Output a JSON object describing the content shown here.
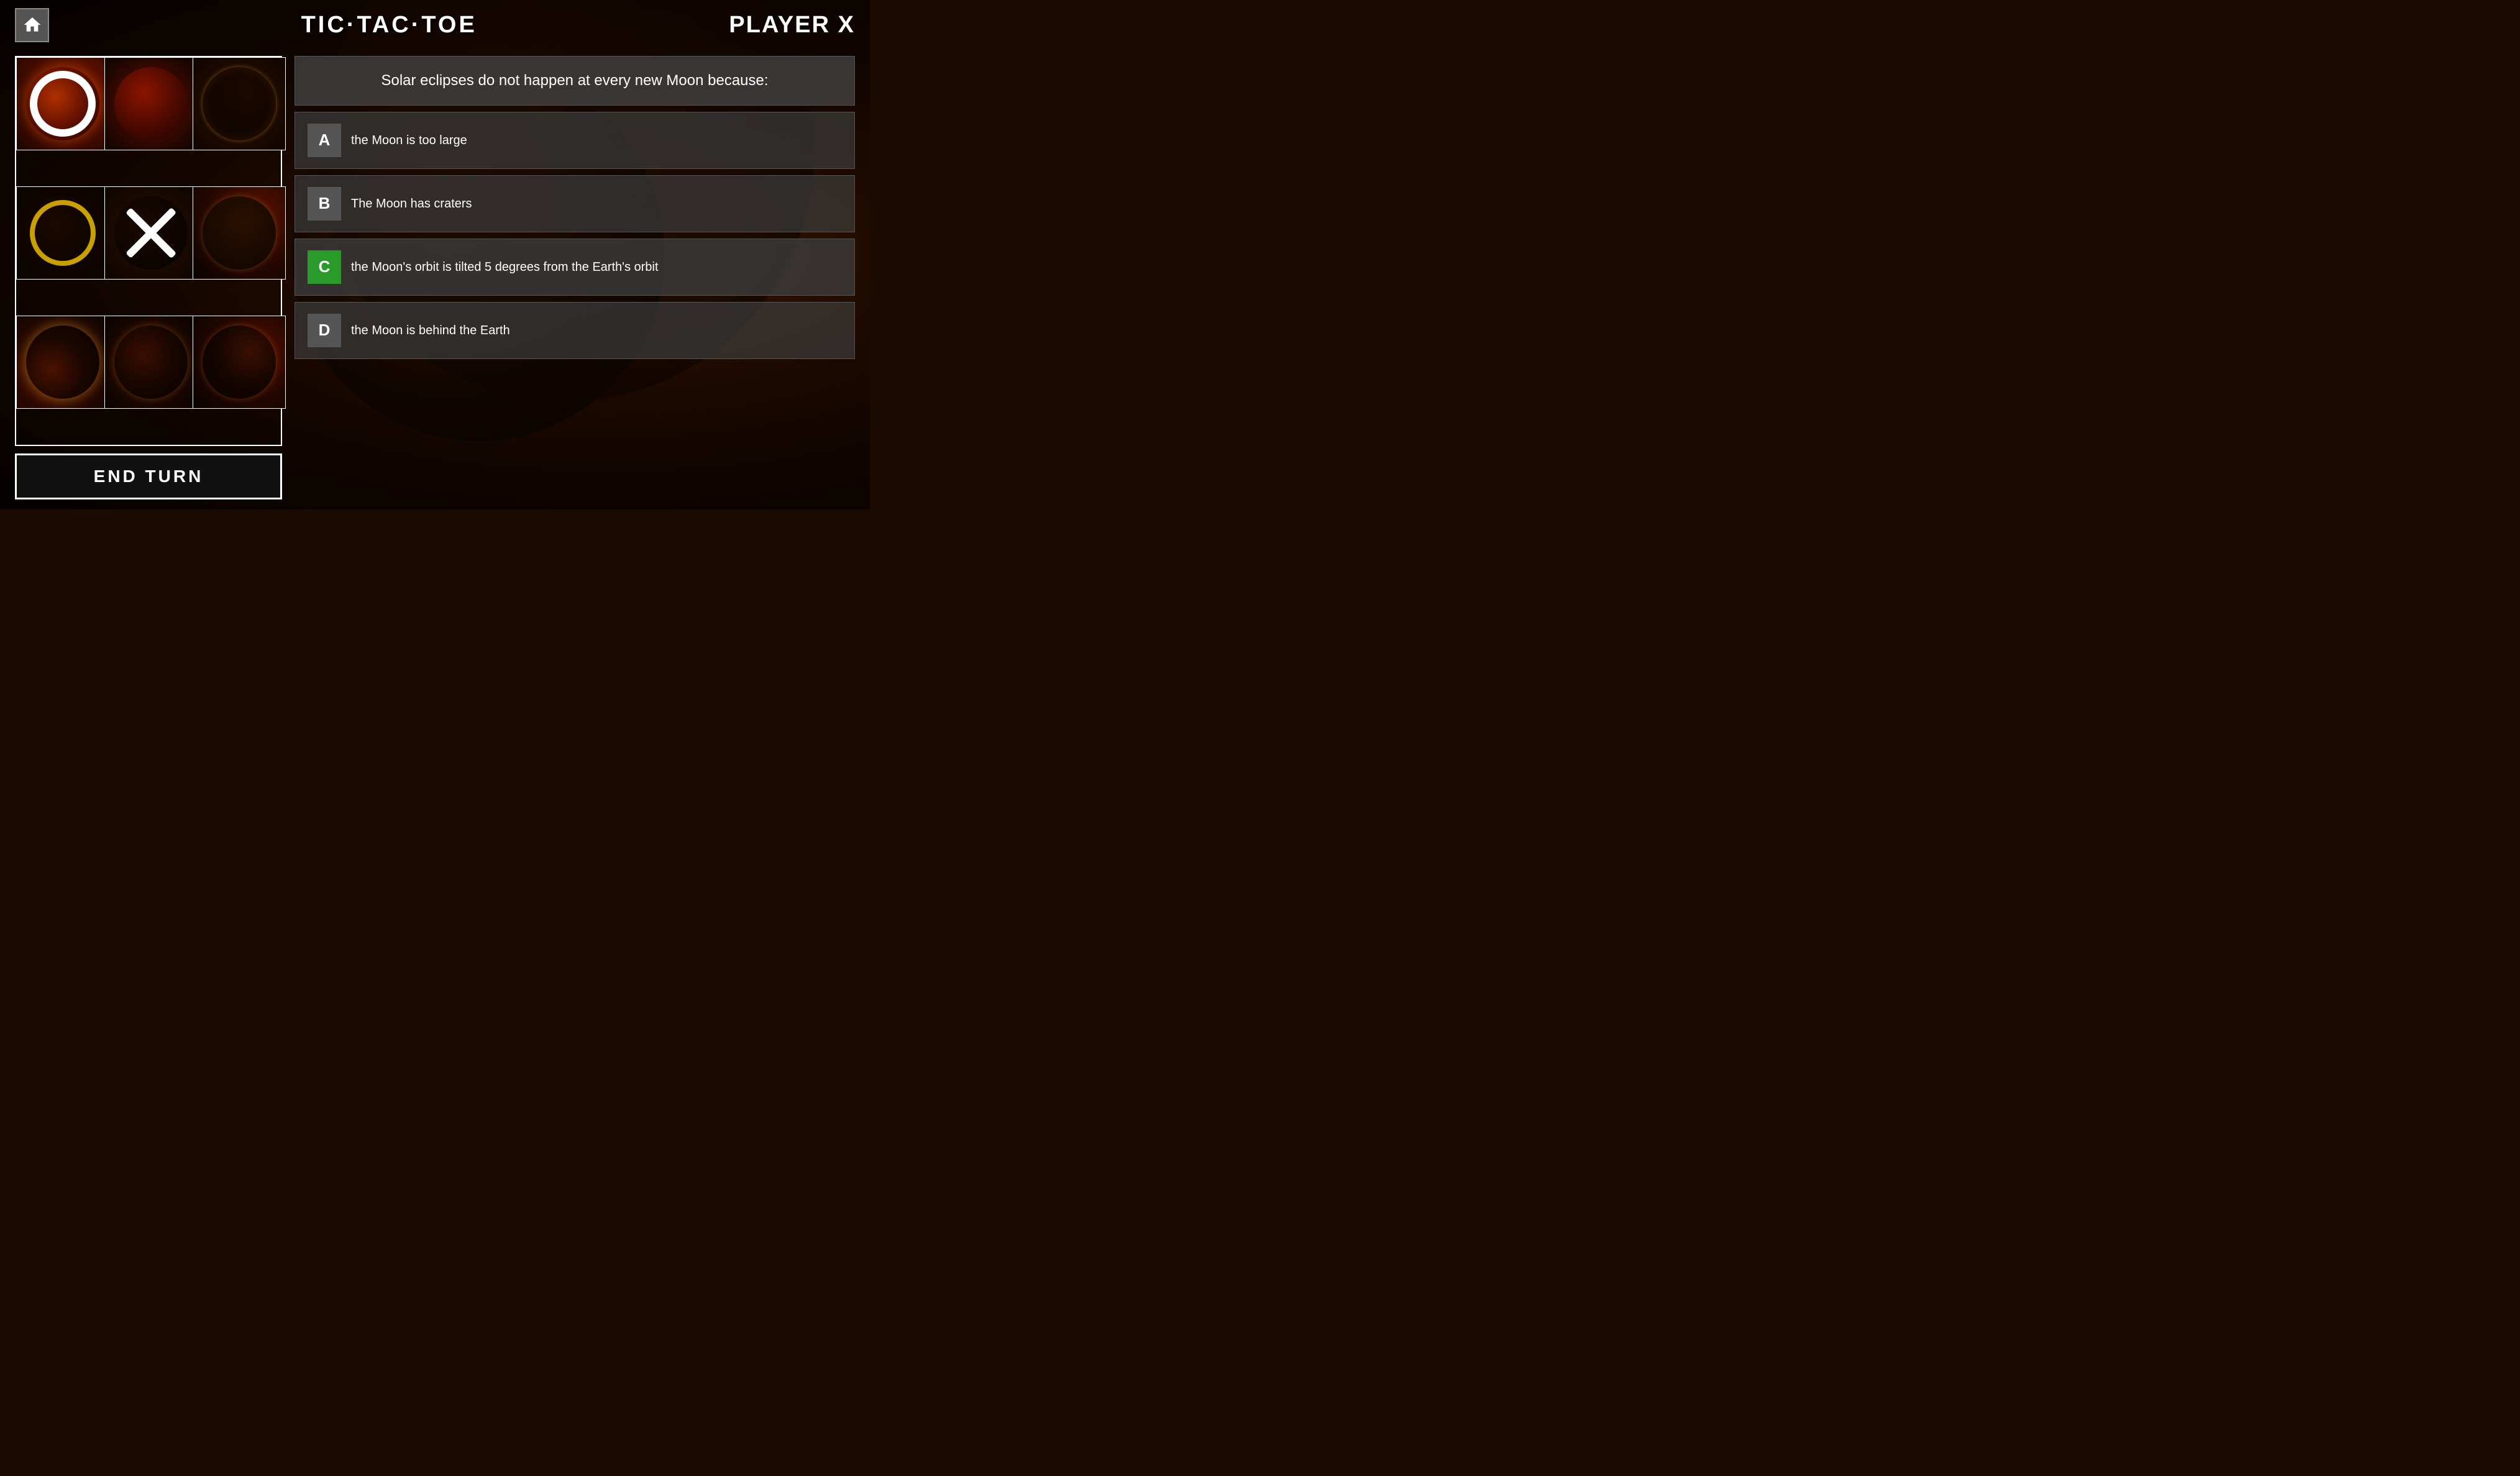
{
  "header": {
    "title": "TIC·TAC·TOE",
    "player_label": "PLAYER X"
  },
  "board": {
    "cells": [
      {
        "id": 1,
        "marker": "o-white",
        "bg_class": "eclipse-1 planet-1"
      },
      {
        "id": 2,
        "marker": null,
        "bg_class": "eclipse-2 planet-2"
      },
      {
        "id": 3,
        "marker": null,
        "bg_class": "eclipse-3 planet-3"
      },
      {
        "id": 4,
        "marker": "o-gold",
        "bg_class": "eclipse-4 planet-4"
      },
      {
        "id": 5,
        "marker": "x",
        "bg_class": "eclipse-5 planet-5"
      },
      {
        "id": 6,
        "marker": null,
        "bg_class": "eclipse-6 planet-6"
      },
      {
        "id": 7,
        "marker": null,
        "bg_class": "eclipse-7 planet-7"
      },
      {
        "id": 8,
        "marker": null,
        "bg_class": "eclipse-8 planet-8"
      },
      {
        "id": 9,
        "marker": null,
        "bg_class": "eclipse-9 planet-9"
      }
    ]
  },
  "end_turn_label": "END TURN",
  "question": {
    "text": "Solar eclipses do not happen at every new Moon because:",
    "answers": [
      {
        "letter": "A",
        "text": "the Moon is too large",
        "selected": false,
        "correct": false
      },
      {
        "letter": "B",
        "text": "The Moon has craters",
        "selected": false,
        "correct": false
      },
      {
        "letter": "C",
        "text": "the Moon's orbit is tilted 5 degrees from the Earth's orbit",
        "selected": true,
        "correct": true
      },
      {
        "letter": "D",
        "text": "the Moon is behind the Earth",
        "selected": false,
        "correct": false
      }
    ]
  }
}
